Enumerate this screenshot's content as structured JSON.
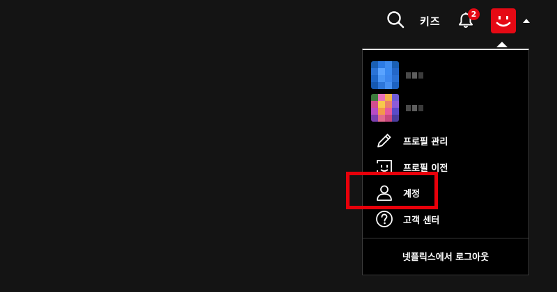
{
  "header": {
    "search_icon": "search-icon",
    "kids_label": "키즈",
    "notifications": {
      "icon": "bell-icon",
      "count": "2"
    },
    "avatar": {
      "icon": "smiley-avatar-icon",
      "color": "#e50914"
    }
  },
  "menu": {
    "profiles": [
      {
        "thumb_colors": [
          "#1a5fb4",
          "#2c7be5",
          "#3d8bf0",
          "#1a5fb4",
          "#2a73d6",
          "#5aa3ff",
          "#3a8af2",
          "#2467c9",
          "#1d66c7",
          "#4b97f6",
          "#3b86ee",
          "#2a70d4",
          "#1558b0",
          "#2d76da",
          "#4690f3",
          "#1d62c2"
        ]
      },
      {
        "thumb_colors": [
          "#3c7a3c",
          "#e86fb8",
          "#f3b24a",
          "#6f5bd6",
          "#d24d8e",
          "#f7c94c",
          "#ec7f6a",
          "#8c5bd8",
          "#b84cc4",
          "#f29a4a",
          "#e8599e",
          "#5a4bc8",
          "#7c3fae",
          "#e36a8c",
          "#c9487f",
          "#4a3d9e"
        ]
      }
    ],
    "items": [
      {
        "label": "프로필 관리",
        "icon": "pencil-icon"
      },
      {
        "label": "프로필 이전",
        "icon": "profile-transfer-icon"
      },
      {
        "label": "계정",
        "icon": "person-icon"
      },
      {
        "label": "고객 센터",
        "icon": "help-circle-icon"
      }
    ],
    "signout_label": "넷플릭스에서 로그아웃"
  },
  "highlight": {
    "color": "#e8000a",
    "target": "계정"
  }
}
